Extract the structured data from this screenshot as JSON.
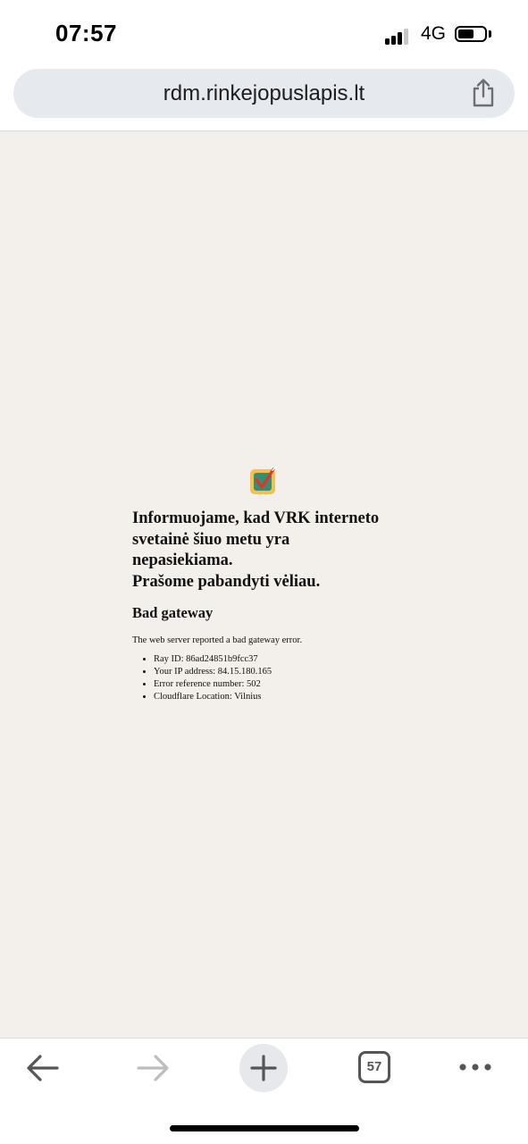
{
  "status_bar": {
    "time": "07:57",
    "network": "4G",
    "icons": [
      "signal-icon",
      "battery-icon"
    ]
  },
  "browser": {
    "url": "rdm.rinkejopuslapis.lt",
    "share_icon": "share-icon",
    "toolbar": {
      "icons": [
        "back-arrow-icon",
        "forward-arrow-icon",
        "plus-icon",
        "tabs-icon",
        "more-icon"
      ],
      "tab_count": "57"
    }
  },
  "page": {
    "logo_icon": "vrk-logo-icon",
    "notice_lines": [
      "Informuojame, kad VRK interneto",
      "svetainė šiuo metu yra",
      "nepasiekiama.",
      "Prašome pabandyti vėliau."
    ],
    "error_title": "Bad gateway",
    "error_description": "The web server reported a bad gateway error.",
    "details": [
      "Ray ID: 86ad24851b9fcc37",
      "Your IP address: 84.15.180.165",
      "Error reference number: 502",
      "Cloudflare Location: Vilnius"
    ]
  },
  "colors": {
    "page_background": "#f3efea",
    "address_bar_background": "#e6e9ee",
    "text": "#111111"
  }
}
